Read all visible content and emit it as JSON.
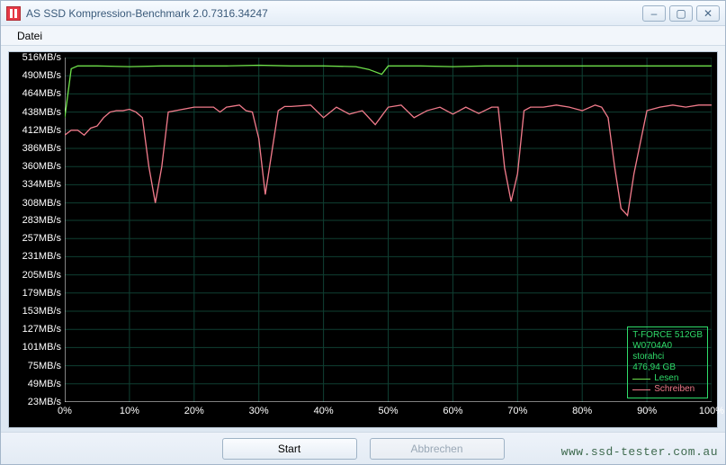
{
  "window": {
    "title": "AS SSD Kompression-Benchmark 2.0.7316.34247",
    "controls": {
      "minimize": "–",
      "maximize": "▢",
      "close": "✕"
    }
  },
  "menu": {
    "file": "Datei"
  },
  "info": {
    "device": "T-FORCE 512GB",
    "firmware": "W0704A0",
    "driver": "storahci",
    "capacity": "476,94 GB",
    "legend_read": "Lesen",
    "legend_write": "Schreiben"
  },
  "buttons": {
    "start": "Start",
    "abort": "Abbrechen"
  },
  "watermark": "www.ssd-tester.com.au",
  "colors": {
    "read": "#6ee04a",
    "write": "#f07a8a",
    "grid": "#0f3f32"
  },
  "chart_data": {
    "type": "line",
    "xlabel": "",
    "ylabel": "",
    "x_ticks": [
      "0%",
      "10%",
      "20%",
      "30%",
      "40%",
      "50%",
      "60%",
      "70%",
      "80%",
      "90%",
      "100%"
    ],
    "y_ticks": [
      "23MB/s",
      "49MB/s",
      "75MB/s",
      "101MB/s",
      "127MB/s",
      "153MB/s",
      "179MB/s",
      "205MB/s",
      "231MB/s",
      "257MB/s",
      "283MB/s",
      "308MB/s",
      "334MB/s",
      "360MB/s",
      "386MB/s",
      "412MB/s",
      "438MB/s",
      "464MB/s",
      "490MB/s",
      "516MB/s"
    ],
    "ylim": [
      23,
      516
    ],
    "xlim": [
      0,
      100
    ],
    "series": [
      {
        "name": "Lesen",
        "color": "#6ee04a",
        "x": [
          0,
          1,
          2,
          5,
          10,
          15,
          20,
          25,
          30,
          35,
          40,
          45,
          47,
          49,
          50,
          55,
          60,
          65,
          70,
          75,
          80,
          85,
          90,
          95,
          100
        ],
        "values": [
          430,
          500,
          504,
          504,
          503,
          504,
          504,
          504,
          505,
          504,
          504,
          503,
          499,
          492,
          504,
          504,
          503,
          504,
          504,
          504,
          504,
          504,
          504,
          504,
          504
        ]
      },
      {
        "name": "Schreiben",
        "color": "#f07a8a",
        "x": [
          0,
          1,
          2,
          3,
          4,
          5,
          6,
          7,
          8,
          9,
          10,
          11,
          12,
          13,
          14,
          15,
          16,
          20,
          22,
          23,
          24,
          25,
          27,
          28,
          29,
          30,
          31,
          32,
          33,
          34,
          35,
          38,
          40,
          42,
          44,
          46,
          48,
          50,
          52,
          54,
          56,
          58,
          60,
          62,
          64,
          66,
          67,
          68,
          69,
          70,
          71,
          72,
          74,
          76,
          78,
          80,
          82,
          83,
          84,
          85,
          86,
          87,
          88,
          90,
          92,
          94,
          96,
          98,
          100
        ],
        "values": [
          405,
          412,
          412,
          405,
          415,
          418,
          430,
          438,
          440,
          440,
          442,
          438,
          430,
          360,
          308,
          360,
          438,
          445,
          445,
          445,
          438,
          445,
          448,
          440,
          438,
          400,
          320,
          380,
          440,
          446,
          446,
          448,
          430,
          445,
          435,
          440,
          420,
          445,
          448,
          430,
          440,
          445,
          435,
          445,
          436,
          445,
          445,
          358,
          310,
          350,
          440,
          445,
          445,
          448,
          445,
          440,
          448,
          445,
          430,
          360,
          300,
          290,
          350,
          440,
          445,
          448,
          445,
          448,
          448
        ]
      }
    ]
  }
}
